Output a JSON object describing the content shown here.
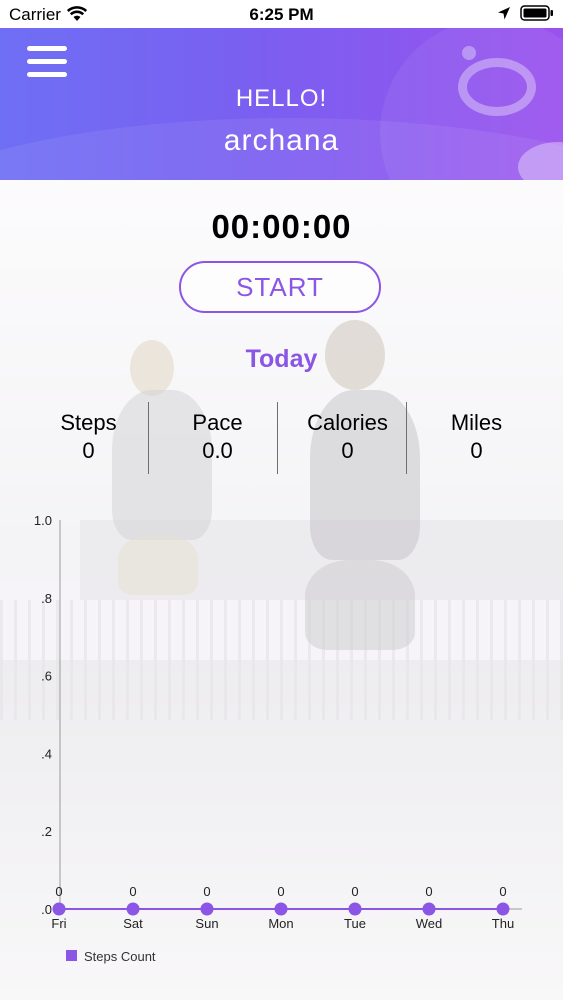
{
  "status_bar": {
    "carrier": "Carrier",
    "time": "6:25 PM",
    "icons": [
      "wifi-icon",
      "location-arrow-icon",
      "battery-icon"
    ]
  },
  "header": {
    "greeting": "HELLO!",
    "username": "archana",
    "menu_icon": "hamburger-menu-icon",
    "gradient": [
      "#6f6ff5",
      "#9a52ee"
    ]
  },
  "timer": {
    "display": "00:00:00",
    "start_label": "START"
  },
  "today_label": "Today",
  "stats": [
    {
      "label": "Steps",
      "value": "0"
    },
    {
      "label": "Pace",
      "value": "0.0"
    },
    {
      "label": "Calories",
      "value": "0"
    },
    {
      "label": "Miles",
      "value": "0"
    }
  ],
  "colors": {
    "accent": "#8b55e6",
    "series": "#8b55e6"
  },
  "chart_data": {
    "type": "line",
    "categories": [
      "Fri",
      "Sat",
      "Sun",
      "Mon",
      "Tue",
      "Wed",
      "Thu"
    ],
    "series": [
      {
        "name": "Steps Count",
        "values": [
          0,
          0,
          0,
          0,
          0,
          0,
          0
        ]
      }
    ],
    "data_labels": [
      "0",
      "0",
      "0",
      "0",
      "0",
      "0",
      "0"
    ],
    "ytick_labels": [
      "1.0",
      ".8",
      ".6",
      ".4",
      ".2",
      ".0"
    ],
    "yticks": [
      1.0,
      0.8,
      0.6,
      0.4,
      0.2,
      0.0
    ],
    "ylim": [
      0,
      1
    ],
    "legend": "bottom-left",
    "grid": false
  }
}
